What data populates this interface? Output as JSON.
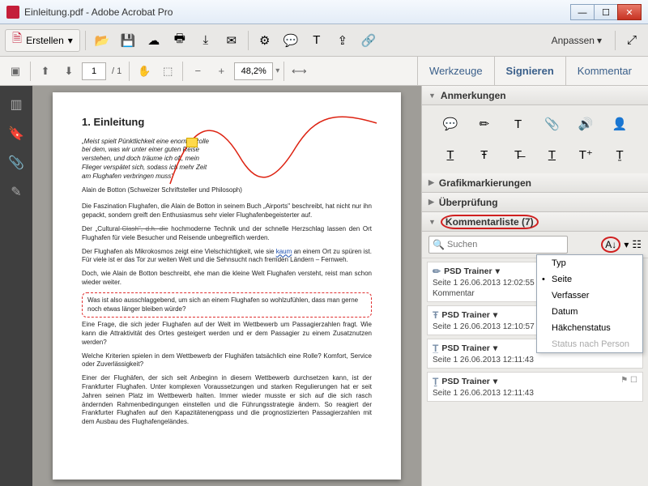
{
  "window": {
    "title": "Einleitung.pdf - Adobe Acrobat Pro"
  },
  "toolbar": {
    "erstellen": "Erstellen",
    "anpassen": "Anpassen"
  },
  "nav": {
    "page_current": "1",
    "page_total": "/ 1",
    "zoom": "48,2%"
  },
  "tabs": {
    "werkzeuge": "Werkzeuge",
    "signieren": "Signieren",
    "kommentar": "Kommentar"
  },
  "panel": {
    "anmerkungen": "Anmerkungen",
    "grafik": "Grafikmarkierungen",
    "ueber": "Überprüfung",
    "klist": "Kommentarliste (7)",
    "search_placeholder": "Suchen",
    "comments": [
      {
        "author": "PSD Trainer",
        "meta": "Seite 1  26.06.2013 12:02:55",
        "extra": "Kommentar"
      },
      {
        "author": "PSD Trainer",
        "meta": "Seite 1  26.06.2013 12:10:57",
        "extra": ""
      },
      {
        "author": "PSD Trainer",
        "meta": "Seite 1  26.06.2013 12:11:43",
        "extra": ""
      },
      {
        "author": "PSD Trainer",
        "meta": "Seite 1  26.06.2013 12:11:43",
        "extra": ""
      }
    ],
    "sortmenu": {
      "typ": "Typ",
      "seite": "Seite",
      "verfasser": "Verfasser",
      "datum": "Datum",
      "haekchen": "Häkchenstatus",
      "status_person": "Status nach Person"
    }
  },
  "doc": {
    "h1": "1. Einleitung",
    "quote": "„Meist spielt Pünktlichkeit eine enorme Rolle bei dem, was wir unter einer guten Reise verstehen, und doch träume ich oft, mein Flieger verspätet sich, sodass ich mehr Zeit am Flughafen verbringen muss\"",
    "author": "Alain de Botton (Schweizer Schriftsteller und Philosoph)",
    "p1": "Die Faszination Flughafen, die Alain de Botton in seinem Buch „Airports\" beschreibt, hat nicht nur ihn gepackt, sondern greift den Enthusiasmus sehr vieler Flughafenbegeisterter auf.",
    "p2a": "Der „Cultural-",
    "p2strike": "Clash\", d.h. die",
    "p2b": " hochmoderne Technik und der schnelle Herzschlag lassen den Ort Flughafen für viele Besucher und Reisende unbegreiflich werden.",
    "p3a": "Der Flughafen als Mikrokosmos zeigt eine Vielschichtigkeit, wie sie ",
    "p3annot": "kaum",
    "p3b": " an einem Ort zu spüren ist. Für viele ist er das Tor zur weiten Welt und die Sehnsucht nach fremden Ländern – Fernweh.",
    "p4": "Doch, wie Alain de Botton beschreibt, ehe man die kleine Welt Flughafen versteht, reist man schon wieder weiter.",
    "callout": "Was ist also ausschlaggebend, um sich an einem Flughafen so wohlzufühlen, dass man gerne noch etwas länger bleiben würde?",
    "p5": "Eine Frage, die sich jeder Flughafen auf der Welt im Wettbewerb um Passagierzahlen fragt. Wie kann die Attraktivität des Ortes gesteigert werden und er dem Passagier zu einem Zusatznutzen werden?",
    "p6": "Welche Kriterien spielen in dem Wettbewerb der Flughäfen tatsächlich eine Rolle? Komfort, Service oder Zuverlässigkeit?",
    "p7": "Einer der Flughäfen, der sich seit Anbeginn in diesem Wettbewerb durchsetzen kann, ist der Frankfurter Flughafen. Unter komplexen Voraussetzungen und starken Regulierungen hat er seit Jahren seinen Platz im Wettbewerb halten. Immer wieder musste er sich auf die sich rasch ändernden Rahmenbedingungen einstellen und die Führungsstrategie ändern. So reagiert der Frankfurter Flughafen auf den Kapazitätenengpass und die prognostizierten Passagierzahlen mit dem Ausbau des Flughafengeländes."
  }
}
